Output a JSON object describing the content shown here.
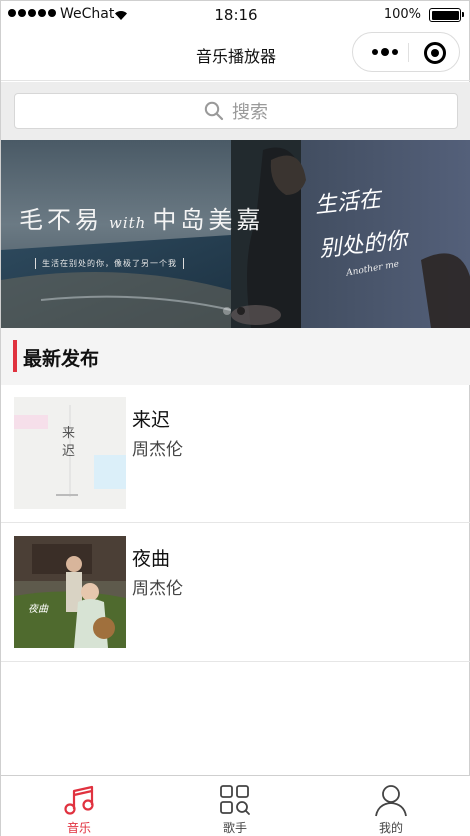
{
  "status_bar": {
    "carrier": "WeChat",
    "time": "18:16",
    "battery": "100%"
  },
  "nav": {
    "title": "音乐播放器"
  },
  "search": {
    "placeholder": "搜索"
  },
  "banner": {
    "artist_left": "毛不易",
    "with": "with",
    "artist_right": "中岛美嘉",
    "tagline": "生活在别处的你，像极了另一个我",
    "script_line1": "生活在",
    "script_line2": "别处的你",
    "signature": "Another me",
    "slide_count": 2,
    "active_slide": 2
  },
  "section": {
    "title": "最新发布"
  },
  "songs": [
    {
      "name": "来迟",
      "singer": "周杰伦",
      "cover_text": "来迟"
    },
    {
      "name": "夜曲",
      "singer": "周杰伦",
      "cover_text": "夜曲"
    }
  ],
  "tabs": [
    {
      "label": "音乐",
      "icon": "music-note-icon",
      "active": true
    },
    {
      "label": "歌手",
      "icon": "grid-search-icon",
      "active": false
    },
    {
      "label": "我的",
      "icon": "person-icon",
      "active": false
    }
  ],
  "colors": {
    "accent": "#e0323f",
    "section_bg": "#f4f4f4",
    "search_bg": "#ededed"
  }
}
